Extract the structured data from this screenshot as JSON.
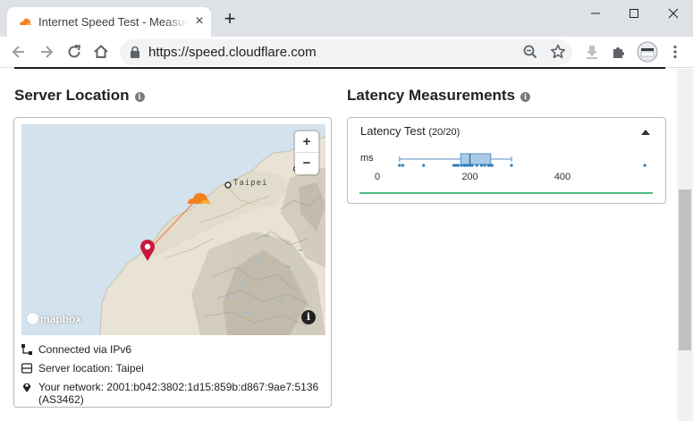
{
  "browser": {
    "tab_title": "Internet Speed Test - Measure",
    "tab_close": "×",
    "new_tab": "+",
    "url": "https://speed.cloudflare.com",
    "favicon": "cloudflare-cloud-icon"
  },
  "server": {
    "title": "Server Location",
    "info_icon": "i",
    "map": {
      "city": "Taipei",
      "zoom_in": "+",
      "zoom_out": "−",
      "logo": "mapbox",
      "attribution": "i"
    },
    "details": [
      {
        "icon": "network-icon",
        "text": "Connected via IPv6"
      },
      {
        "icon": "server-icon",
        "text": "Server location: Taipei"
      },
      {
        "icon": "location-pin-icon",
        "text": "Your network: 2001:b042:3802:1d15:859b:d867:9ae7:5136 (AS3462)"
      }
    ]
  },
  "latency": {
    "title": "Latency Measurements",
    "info_icon": "i",
    "test_label": "Latency Test",
    "count": "(20/20)",
    "unit": "ms",
    "axis_ticks": [
      "0",
      "200",
      "400"
    ],
    "box": {
      "min": 48,
      "q1": 180,
      "median": 200,
      "q3": 245,
      "max": 290
    },
    "points": [
      48,
      55,
      100,
      165,
      170,
      175,
      182,
      188,
      190,
      195,
      200,
      205,
      215,
      225,
      232,
      240,
      243,
      248,
      290,
      578
    ],
    "accent": "#4cbc81",
    "box_color": "#a9cbe8"
  }
}
